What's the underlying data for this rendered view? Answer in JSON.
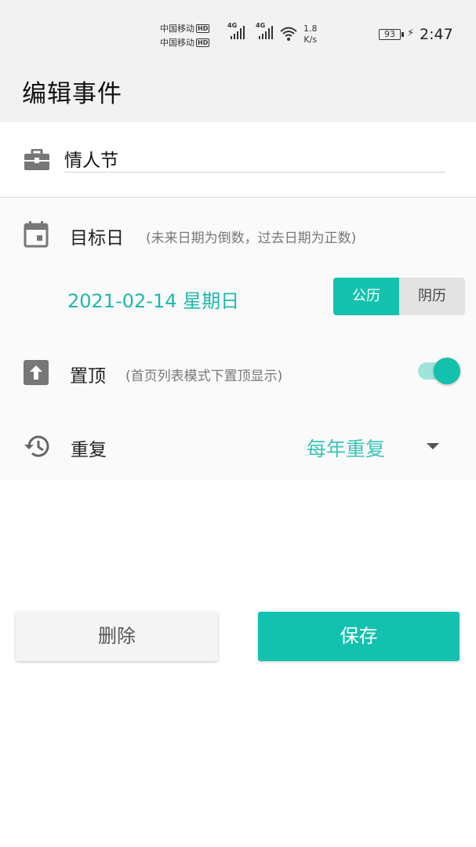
{
  "status_bar": {
    "carrier_1": "中国移动",
    "carrier_2": "中国移动",
    "hd_badge": "HD",
    "network_1": "4G",
    "network_2": "4G",
    "speed_value": "1.8",
    "speed_unit": "K/s",
    "battery": "93",
    "time": "2:47",
    "icons": [
      "signal-icon",
      "wifi-icon",
      "battery-icon",
      "charging-icon"
    ]
  },
  "header": {
    "title": "编辑事件"
  },
  "event_name": {
    "icon": "briefcase-icon",
    "value": "情人节"
  },
  "target_date": {
    "icon": "calendar-icon",
    "label": "目标日",
    "hint": "(未来日期为倒数，过去日期为正数)",
    "date": "2021-02-14 星期日",
    "calendar_options": [
      "公历",
      "阴历"
    ],
    "selected_calendar": "公历"
  },
  "pin": {
    "icon": "pin-to-top-icon",
    "label": "置顶",
    "hint": "(首页列表模式下置顶显示)",
    "enabled": true
  },
  "repeat": {
    "icon": "history-icon",
    "label": "重复",
    "value": "每年重复"
  },
  "actions": {
    "delete_label": "删除",
    "save_label": "保存"
  },
  "colors": {
    "accent": "#15c2ae",
    "accent_text": "#1fb8ac",
    "toggle_track": "#9ee4db"
  }
}
